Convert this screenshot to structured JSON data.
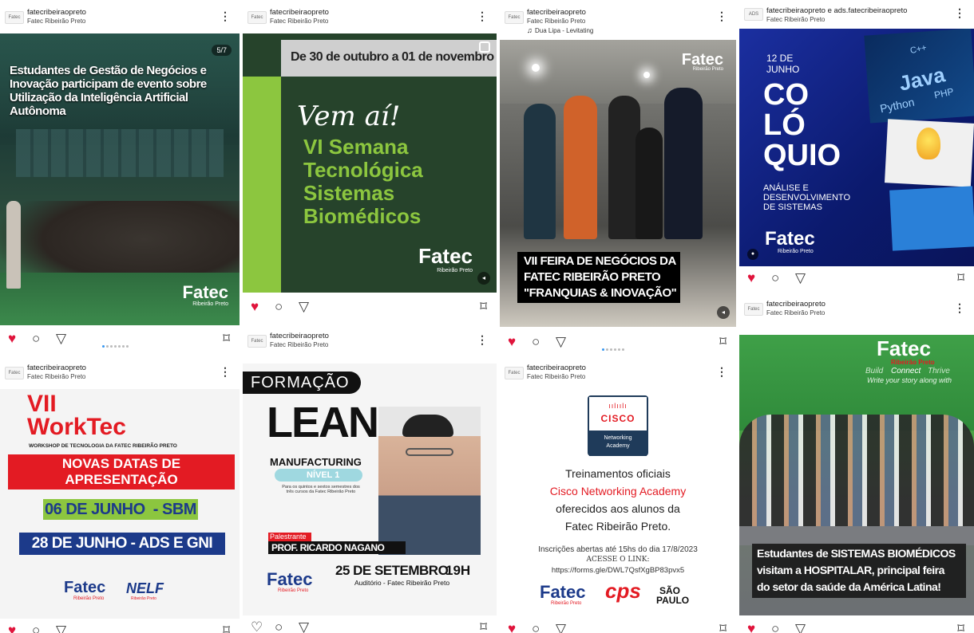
{
  "posts": [
    {
      "user": "fatecribeiraopreto",
      "sub": "Fatec Ribeirão Preto",
      "counter": "5/7",
      "title": "Estudantes de Gestão de Negócios e Inovação participam de evento sobre Utilização da Inteligência Artificial Autônoma",
      "brand": "Fatec",
      "brand_sub": "Ribeirão Preto"
    },
    {
      "user": "fatecribeiraopreto",
      "sub": "Fatec Ribeirão Preto",
      "banner": "De 30 de outubro a 01 de novembro",
      "script": "Vem aí!",
      "title_lines": [
        "VI Semana",
        "Tecnológica",
        "Sistemas",
        "Biomédicos"
      ],
      "brand": "Fatec",
      "brand_sub": "Ribeirão Preto"
    },
    {
      "user": "fatecribeiraopreto",
      "sub": "Fatec Ribeirão Preto",
      "music": "Dua Lipa - Levitating",
      "brand": "Fatec",
      "brand_sub": "Ribeirão Preto",
      "caption_lines": [
        "VII FEIRA DE NEGÓCIOS DA",
        "FATEC RIBEIRÃO PRETO",
        "\"FRANQUIAS & INOVAÇÃO\""
      ]
    },
    {
      "user": "fatecribeiraopreto e ads.fatecribeiraopreto",
      "sub": "Fatec Ribeirão Preto",
      "date_line1": "12 DE",
      "date_line2": "JUNHO",
      "big_lines": [
        "CO",
        "LÓ",
        "QUIO"
      ],
      "subtitle_lines": [
        "ANÁLISE E",
        "DESENVOLVIMENTO",
        "DE SISTEMAS"
      ],
      "brand": "Fatec",
      "brand_sub": "Ribeirão Preto",
      "langs": [
        "Java",
        "Python",
        "PHP",
        "C++"
      ]
    },
    {
      "user": "fatecribeiraopreto",
      "sub": "Fatec Ribeirão Preto",
      "big1": "VII",
      "big2": "WorkTec",
      "workshop": "WORKSHOP DE TECNOLOGIA DA FATEC RIBEIRÃO PRETO",
      "red_lines": [
        "NOVAS DATAS DE",
        "APRESENTAÇÃO"
      ],
      "date1": "06 DE JUNHO  - SBM",
      "date2": "28 DE JUNHO - ADS E GNI",
      "brand": "Fatec",
      "brand_sub": "Ribeirão Preto",
      "nelf": "NELF",
      "nelf_sub": "Ribeirão Preto"
    },
    {
      "user": "fatecribeiraopreto",
      "sub": "Fatec Ribeirão Preto",
      "tag": "FORMAÇÃO",
      "lean": "LEAN",
      "manuf": "MANUFACTURING",
      "nivel": "NÍVEL 1",
      "desc": "Para os quintos e sextos semestres dos três cursos da Fatec Ribeirão Preto",
      "palestrante": "Palestrante",
      "speaker": "PROF. RICARDO NAGANO",
      "date": "25 DE SETEMBRO",
      "time": "19H",
      "venue": "Auditório - Fatec Ribeirão Preto",
      "brand": "Fatec",
      "brand_sub": "Ribeirão Preto"
    },
    {
      "user": "fatecribeiraopreto",
      "sub": "Fatec Ribeirão Preto",
      "cisco": "CISCO",
      "cisco_sub1": "Networking",
      "cisco_sub2": "Academy",
      "lines": [
        "Treinamentos oficiais",
        "Cisco Networking Academy",
        "oferecidos aos alunos da",
        "Fatec Ribeirão Preto."
      ],
      "insc": "Inscrições abertas até 15hs do dia 17/8/2023",
      "acesse": "ACESSE O LINK:",
      "link": "https://forms.gle/DWL7QsfXgBP83pvx5",
      "brand": "Fatec",
      "brand_sub": "Ribeirão Preto",
      "cps": "cps",
      "sp1": "SÃO",
      "sp2": "PAULO"
    },
    {
      "user": "fatecribeiraopreto",
      "sub": "Fatec Ribeirão Preto",
      "wall_brand": "Fatec",
      "wall_sub": "Ribeirão Preto",
      "wall_words": [
        "Build",
        "Connect",
        "Thrive"
      ],
      "wall_slogan": "Write your story along with",
      "caption_lines": [
        "Estudantes de SISTEMAS BIOMÉDICOS",
        "visitam a HOSPITALAR, principal feira",
        "do setor da saúde da América Latina!"
      ]
    }
  ],
  "colors": {
    "like": "#e0143c",
    "accent": "#3897f0",
    "green_dark": "#26432b",
    "green_lime": "#8cc63f",
    "navy": "#0b1a6e",
    "red": "#e31b23"
  },
  "icons": [
    "heart-icon",
    "comment-icon",
    "share-icon",
    "bookmark-icon",
    "more-icon",
    "music-icon",
    "mute-icon"
  ]
}
